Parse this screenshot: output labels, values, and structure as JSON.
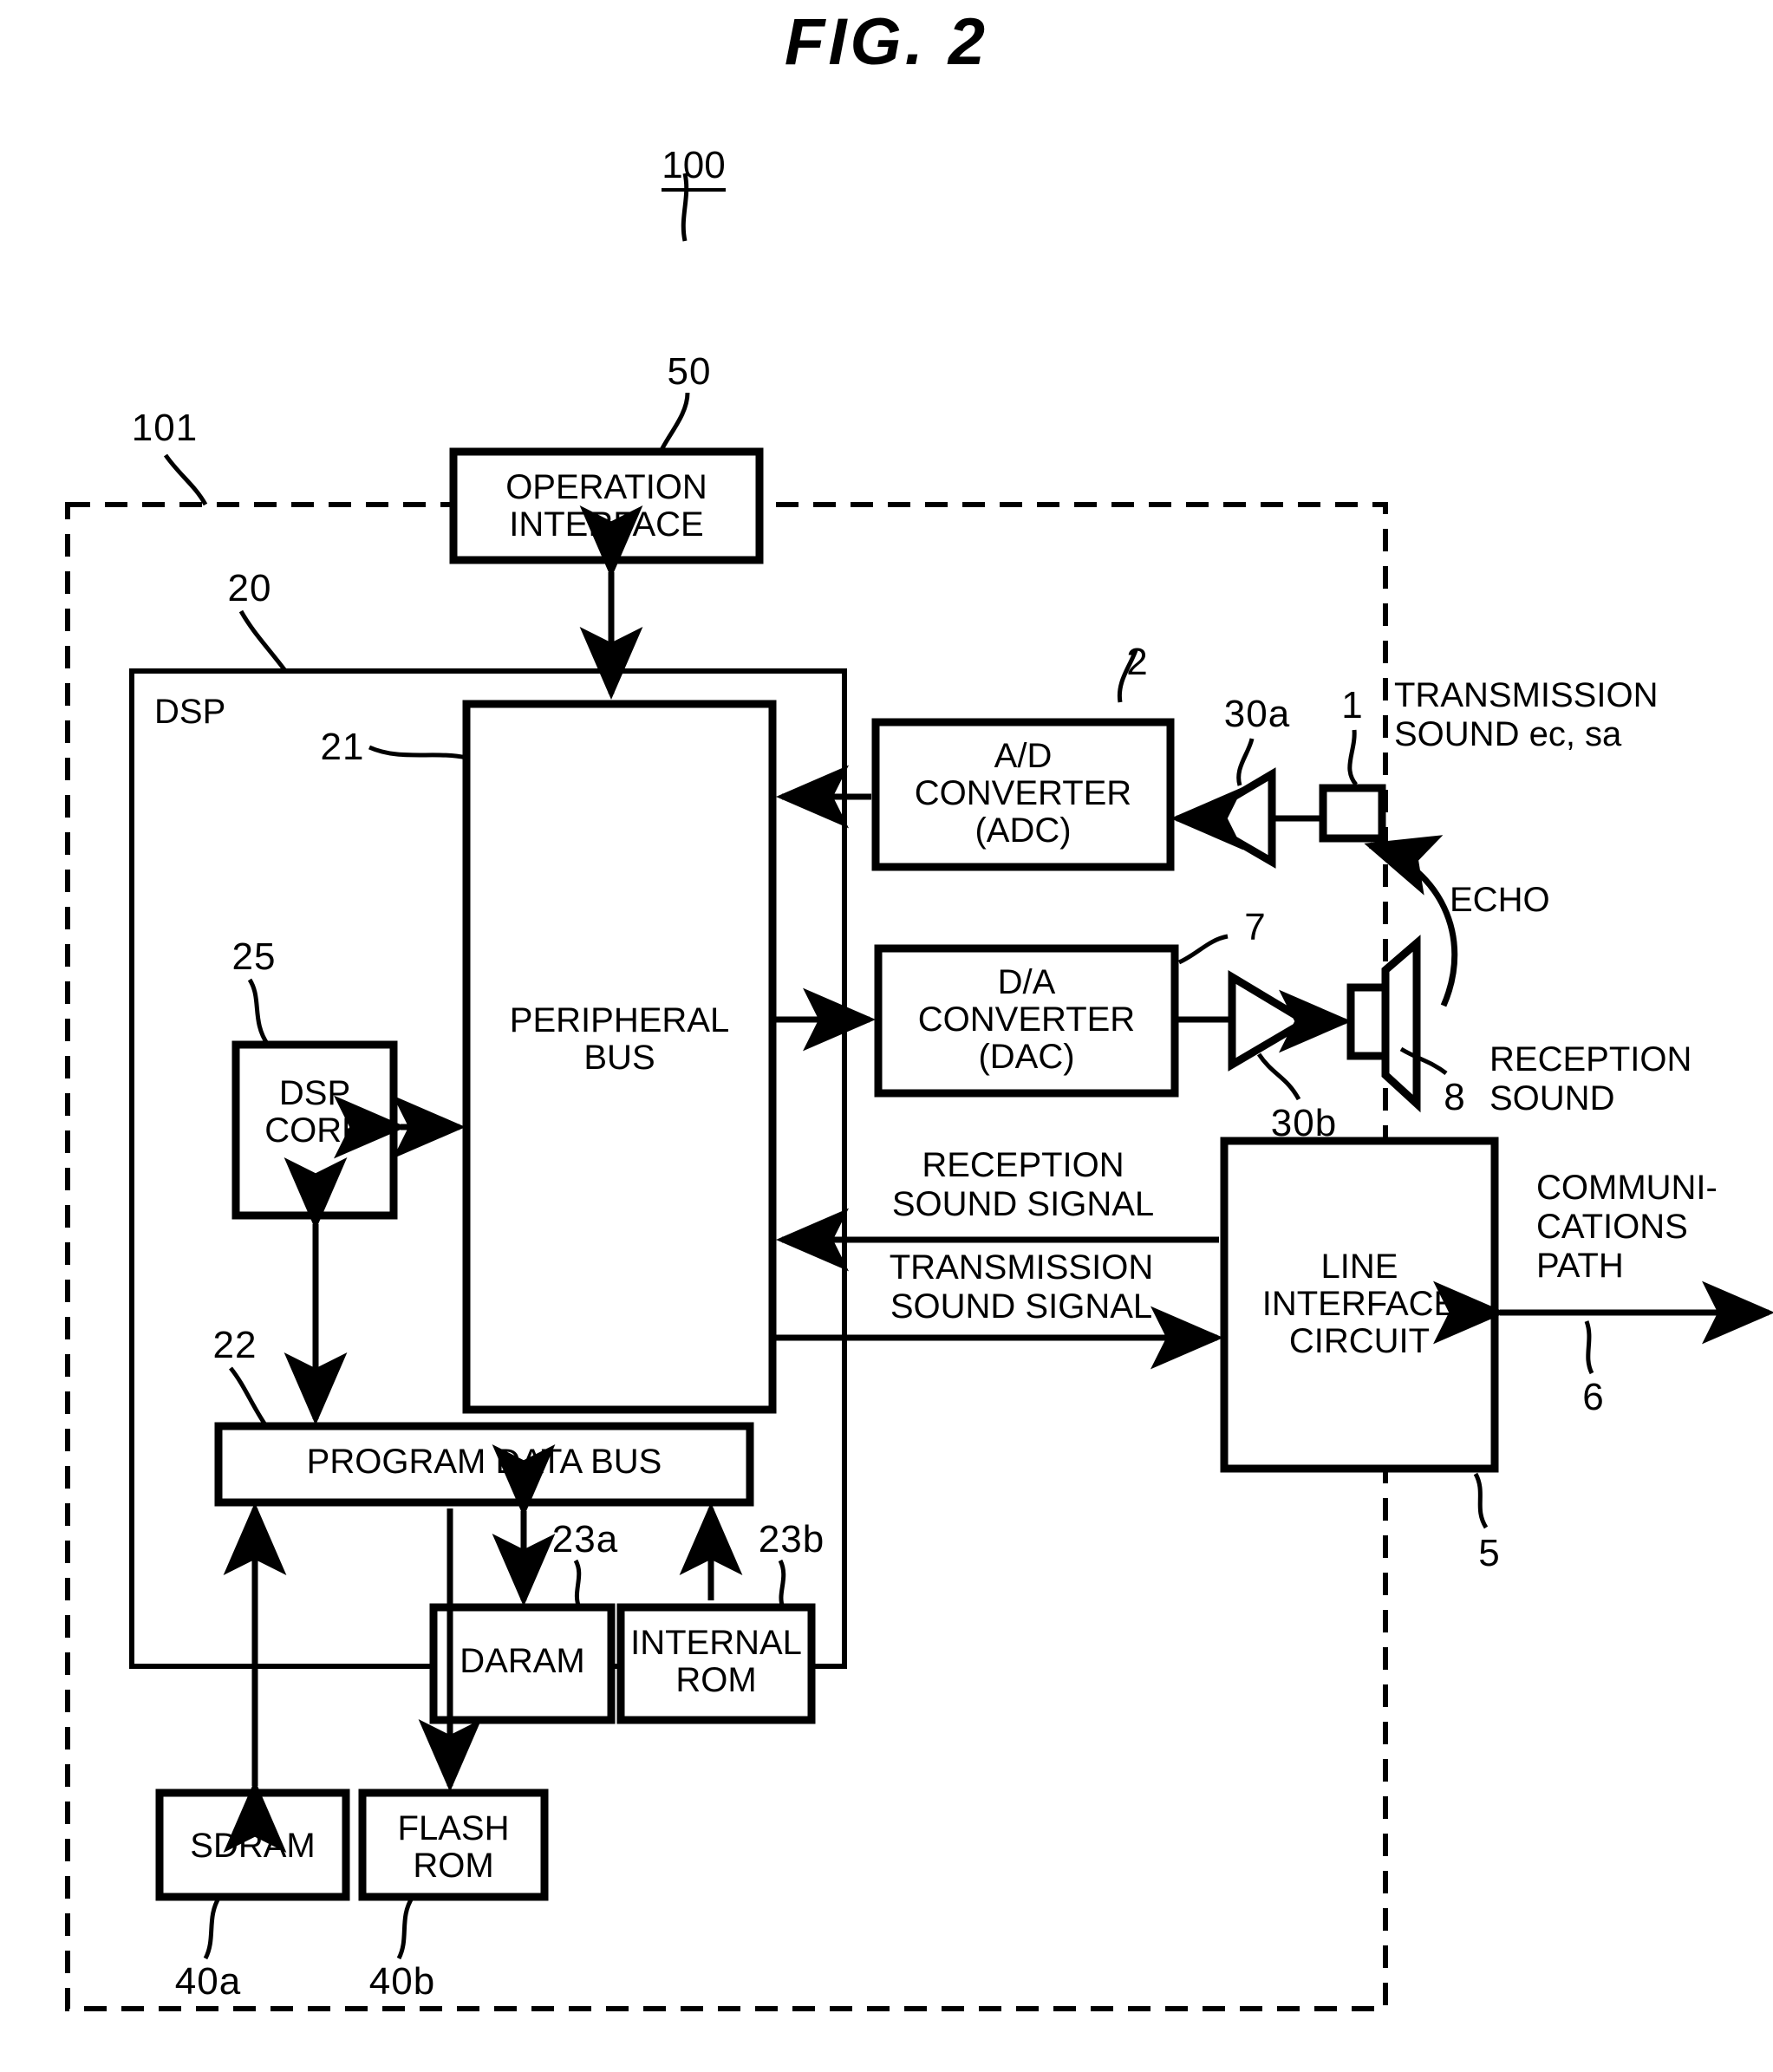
{
  "figure": {
    "title": "FIG.  2",
    "system_ref": "100",
    "enclosure_ref": "101"
  },
  "blocks": [
    {
      "id": "operation-interface",
      "label": "OPERATION\nINTERFACE",
      "ref": "50"
    },
    {
      "id": "dsp",
      "label": "DSP",
      "ref": "20"
    },
    {
      "id": "peripheral-bus",
      "label": "PERIPHERAL\nBUS",
      "ref": "21"
    },
    {
      "id": "dsp-core",
      "label": "DSP\nCORE",
      "ref": "25"
    },
    {
      "id": "program-data-bus",
      "label": "PROGRAM DATA BUS",
      "ref": "22"
    },
    {
      "id": "daram",
      "label": "DARAM",
      "ref": "23a"
    },
    {
      "id": "internal-rom",
      "label": "INTERNAL\nROM",
      "ref": "23b"
    },
    {
      "id": "sdram",
      "label": "SDRAM",
      "ref": "40a"
    },
    {
      "id": "flash-rom",
      "label": "FLASH\nROM",
      "ref": "40b"
    },
    {
      "id": "adc",
      "label": "A/D\nCONVERTER\n(ADC)",
      "ref": "2"
    },
    {
      "id": "dac",
      "label": "D/A\nCONVERTER\n(DAC)",
      "ref": "7"
    },
    {
      "id": "line-interface-circuit",
      "label": "LINE\nINTERFACE\nCIRCUIT",
      "ref": "5"
    }
  ],
  "components": [
    {
      "id": "mic-amplifier",
      "ref": "30a"
    },
    {
      "id": "microphone",
      "ref": "1"
    },
    {
      "id": "speaker-amplifier",
      "ref": "30b"
    },
    {
      "id": "speaker",
      "ref": "8"
    },
    {
      "id": "communications-path",
      "ref": "6"
    }
  ],
  "annotations": {
    "transmission_sound": "TRANSMISSION\nSOUND ec, sa",
    "echo": "ECHO",
    "reception_sound": "RECEPTION\nSOUND",
    "communications_path": "COMMUNI-\nCATIONS\nPATH",
    "reception_sound_signal": "RECEPTION\nSOUND SIGNAL",
    "transmission_sound_signal": "TRANSMISSION\nSOUND SIGNAL"
  },
  "colors": {
    "ink": "#000000",
    "paper": "#ffffff"
  }
}
